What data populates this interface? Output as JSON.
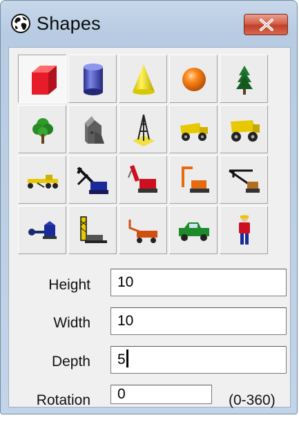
{
  "window": {
    "title": "Shapes",
    "title_icon": "globe-icon",
    "close_icon": "close-icon"
  },
  "shapes": [
    {
      "name": "cube",
      "icon": "red-cube-icon"
    },
    {
      "name": "cylinder",
      "icon": "blue-cylinder-icon"
    },
    {
      "name": "cone",
      "icon": "yellow-cone-icon"
    },
    {
      "name": "sphere",
      "icon": "orange-sphere-icon"
    },
    {
      "name": "pine-tree",
      "icon": "pine-tree-icon"
    },
    {
      "name": "deciduous-tree",
      "icon": "deciduous-tree-icon"
    },
    {
      "name": "building",
      "icon": "gray-building-icon"
    },
    {
      "name": "tower",
      "icon": "tower-icon"
    },
    {
      "name": "dump-truck",
      "icon": "dump-truck-icon"
    },
    {
      "name": "haul-truck",
      "icon": "haul-truck-icon"
    },
    {
      "name": "grader",
      "icon": "grader-icon"
    },
    {
      "name": "dragline",
      "icon": "dragline-icon"
    },
    {
      "name": "shovel",
      "icon": "shovel-icon"
    },
    {
      "name": "excavator",
      "icon": "excavator-icon"
    },
    {
      "name": "crane",
      "icon": "crane-icon"
    },
    {
      "name": "drill",
      "icon": "drill-icon"
    },
    {
      "name": "drill-rig",
      "icon": "drill-rig-icon"
    },
    {
      "name": "conveyor-truck",
      "icon": "conveyor-truck-icon"
    },
    {
      "name": "pickup-truck",
      "icon": "pickup-truck-icon"
    },
    {
      "name": "person",
      "icon": "person-icon"
    }
  ],
  "selected_index": 0,
  "fields": {
    "height": {
      "label": "Height",
      "value": "10"
    },
    "width": {
      "label": "Width",
      "value": "10"
    },
    "depth": {
      "label": "Depth",
      "value": "5"
    },
    "rotation": {
      "label": "Rotation",
      "value": "0",
      "range": "(0-360)"
    }
  }
}
